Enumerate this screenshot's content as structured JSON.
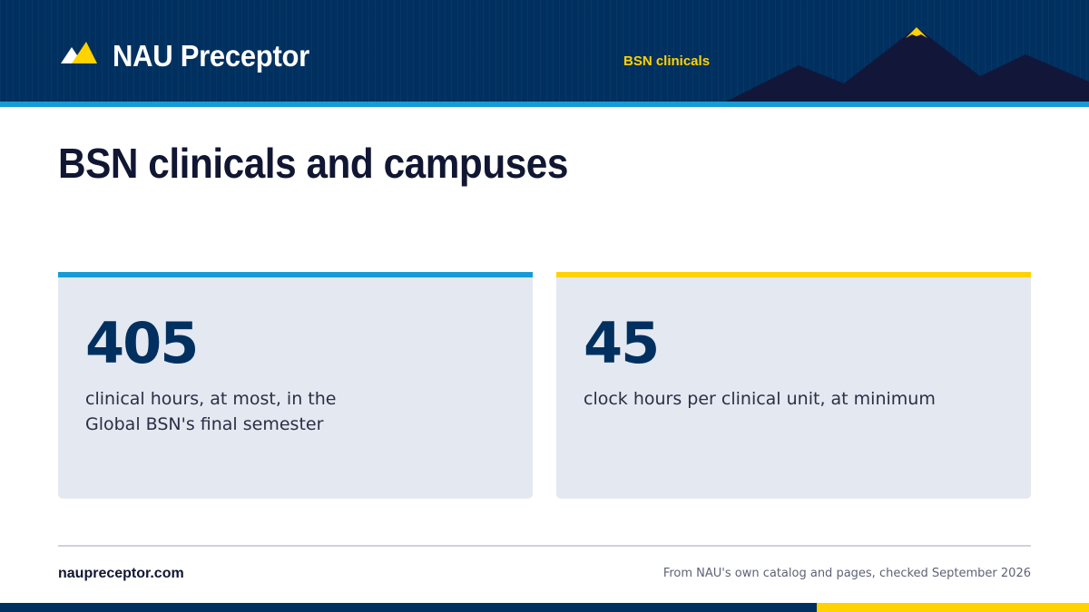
{
  "header": {
    "brand": "NAU Preceptor",
    "nav_link": "BSN clinicals"
  },
  "page": {
    "title": "BSN clinicals and campuses"
  },
  "stats": [
    {
      "value": "405",
      "description": "clinical hours, at most, in the Global BSN's final semester"
    },
    {
      "value": "45",
      "description": "clock hours per clinical unit, at minimum"
    }
  ],
  "footer": {
    "site": "naupreceptor.com",
    "source": "From NAU's own catalog and pages, checked September 2026"
  },
  "colors": {
    "navy": "#00305f",
    "sky": "#179bd7",
    "gold": "#ffd200",
    "card_bg": "#e4e8f1",
    "mountain": "#12173a"
  },
  "icons": {
    "logo": "mountain-logo-icon",
    "header_art": "mountain-range-icon"
  }
}
